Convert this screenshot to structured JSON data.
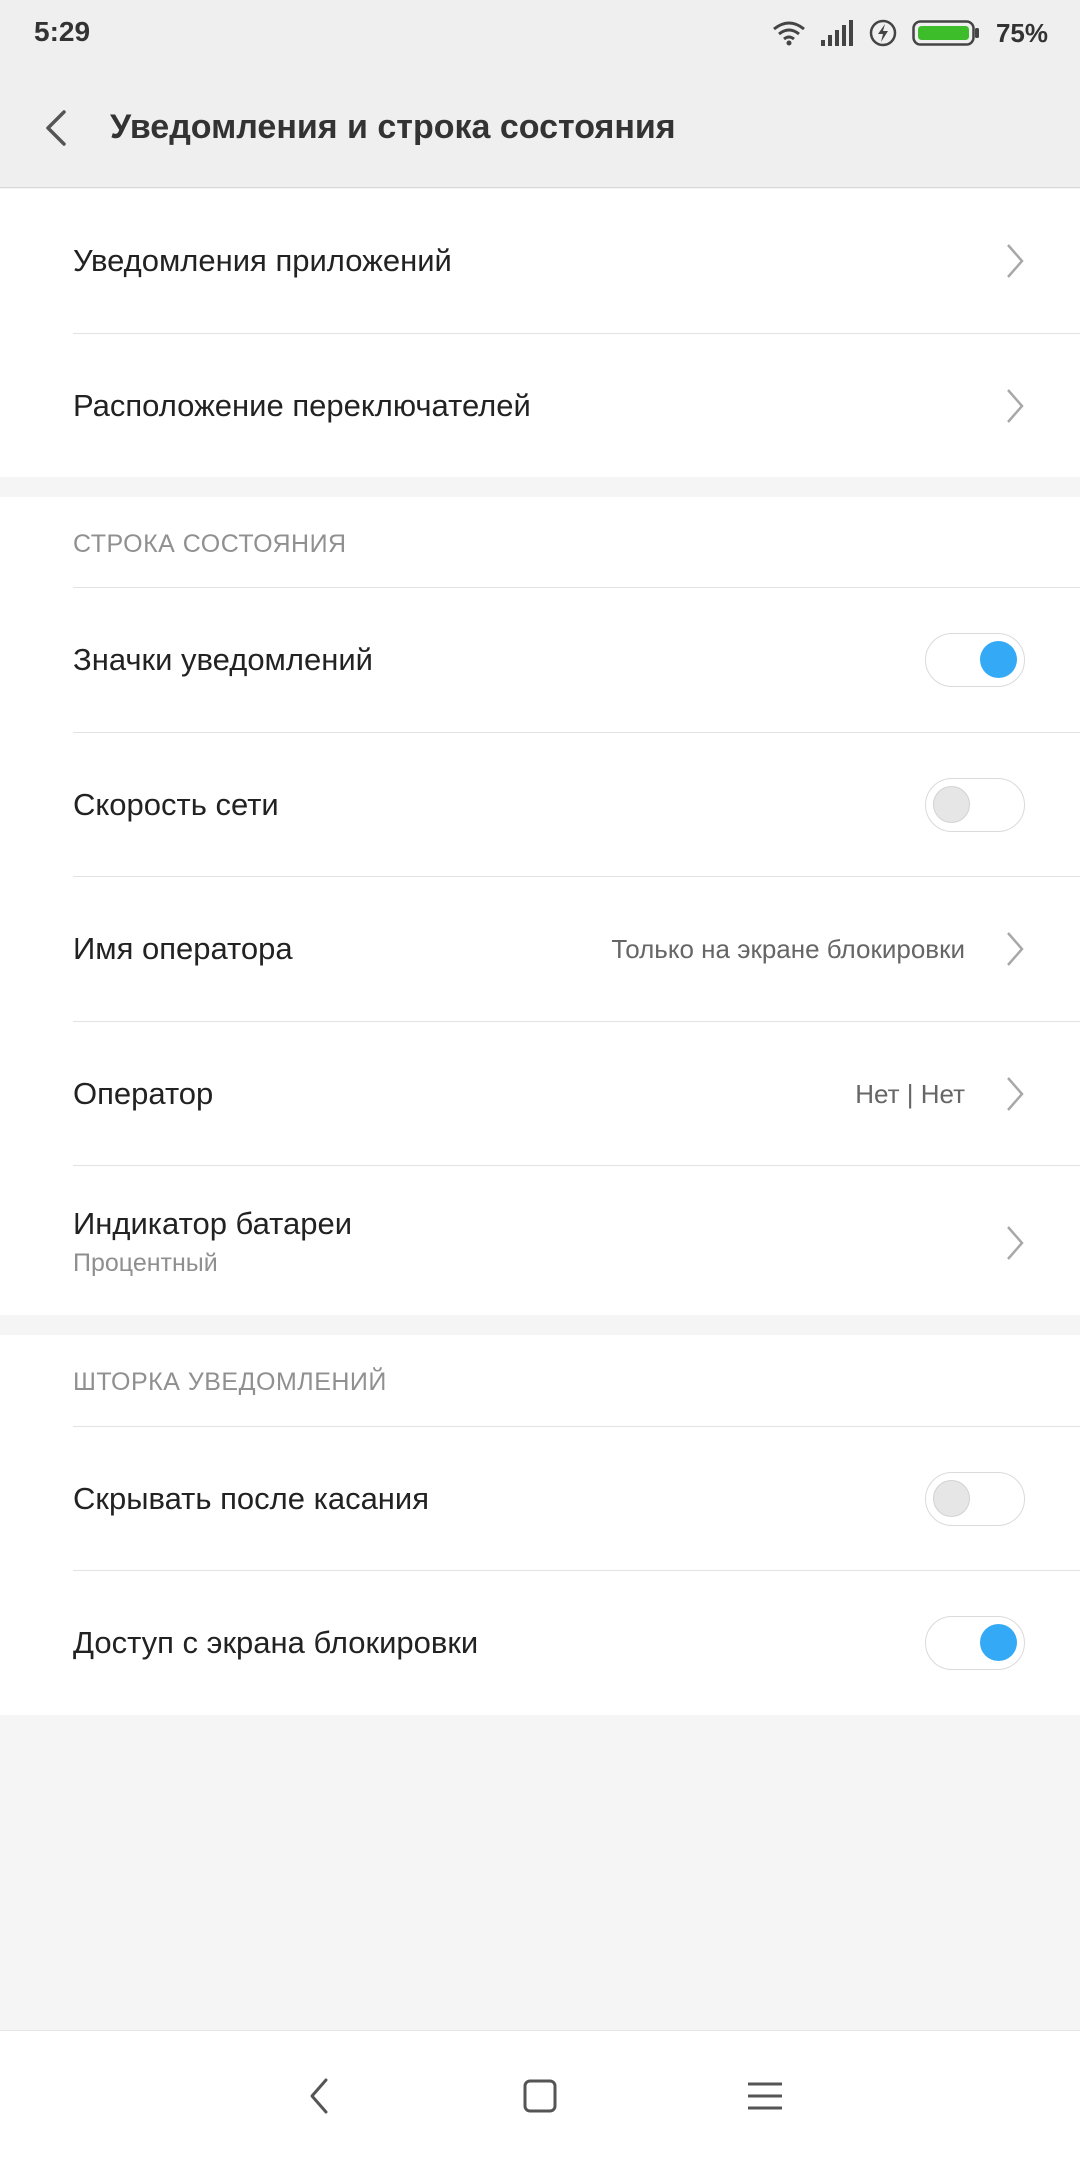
{
  "status_bar": {
    "time": "5:29",
    "battery_percent": "75%",
    "icons": [
      "wifi-icon",
      "signal-icon",
      "charging-icon",
      "battery-icon"
    ],
    "battery_color": "#3dbd2a"
  },
  "header": {
    "title": "Уведомления и строка состояния",
    "back_icon": "back-arrow-icon"
  },
  "top_section": {
    "items": [
      {
        "label": "Уведомления приложений"
      },
      {
        "label": "Расположение переключателей"
      }
    ]
  },
  "status_bar_section": {
    "header": "СТРОКА СОСТОЯНИЯ",
    "items": [
      {
        "label": "Значки уведомлений",
        "toggle": true
      },
      {
        "label": "Скорость сети",
        "toggle": false
      },
      {
        "label": "Имя оператора",
        "value": "Только на экране блокировки"
      },
      {
        "label": "Оператор",
        "value": "Нет | Нет"
      },
      {
        "label": "Индикатор батареи",
        "sublabel": "Процентный"
      }
    ]
  },
  "shade_section": {
    "header": "ШТОРКА УВЕДОМЛЕНИЙ",
    "items": [
      {
        "label": "Скрывать после касания",
        "toggle": false
      },
      {
        "label": "Доступ с экрана блокировки",
        "toggle": true
      }
    ]
  },
  "nav_bar": {
    "icons": [
      "nav-back-icon",
      "nav-home-icon",
      "nav-menu-icon"
    ]
  },
  "colors": {
    "accent": "#34aaf6",
    "background": "#f5f5f5",
    "header_bg": "#efefef"
  }
}
